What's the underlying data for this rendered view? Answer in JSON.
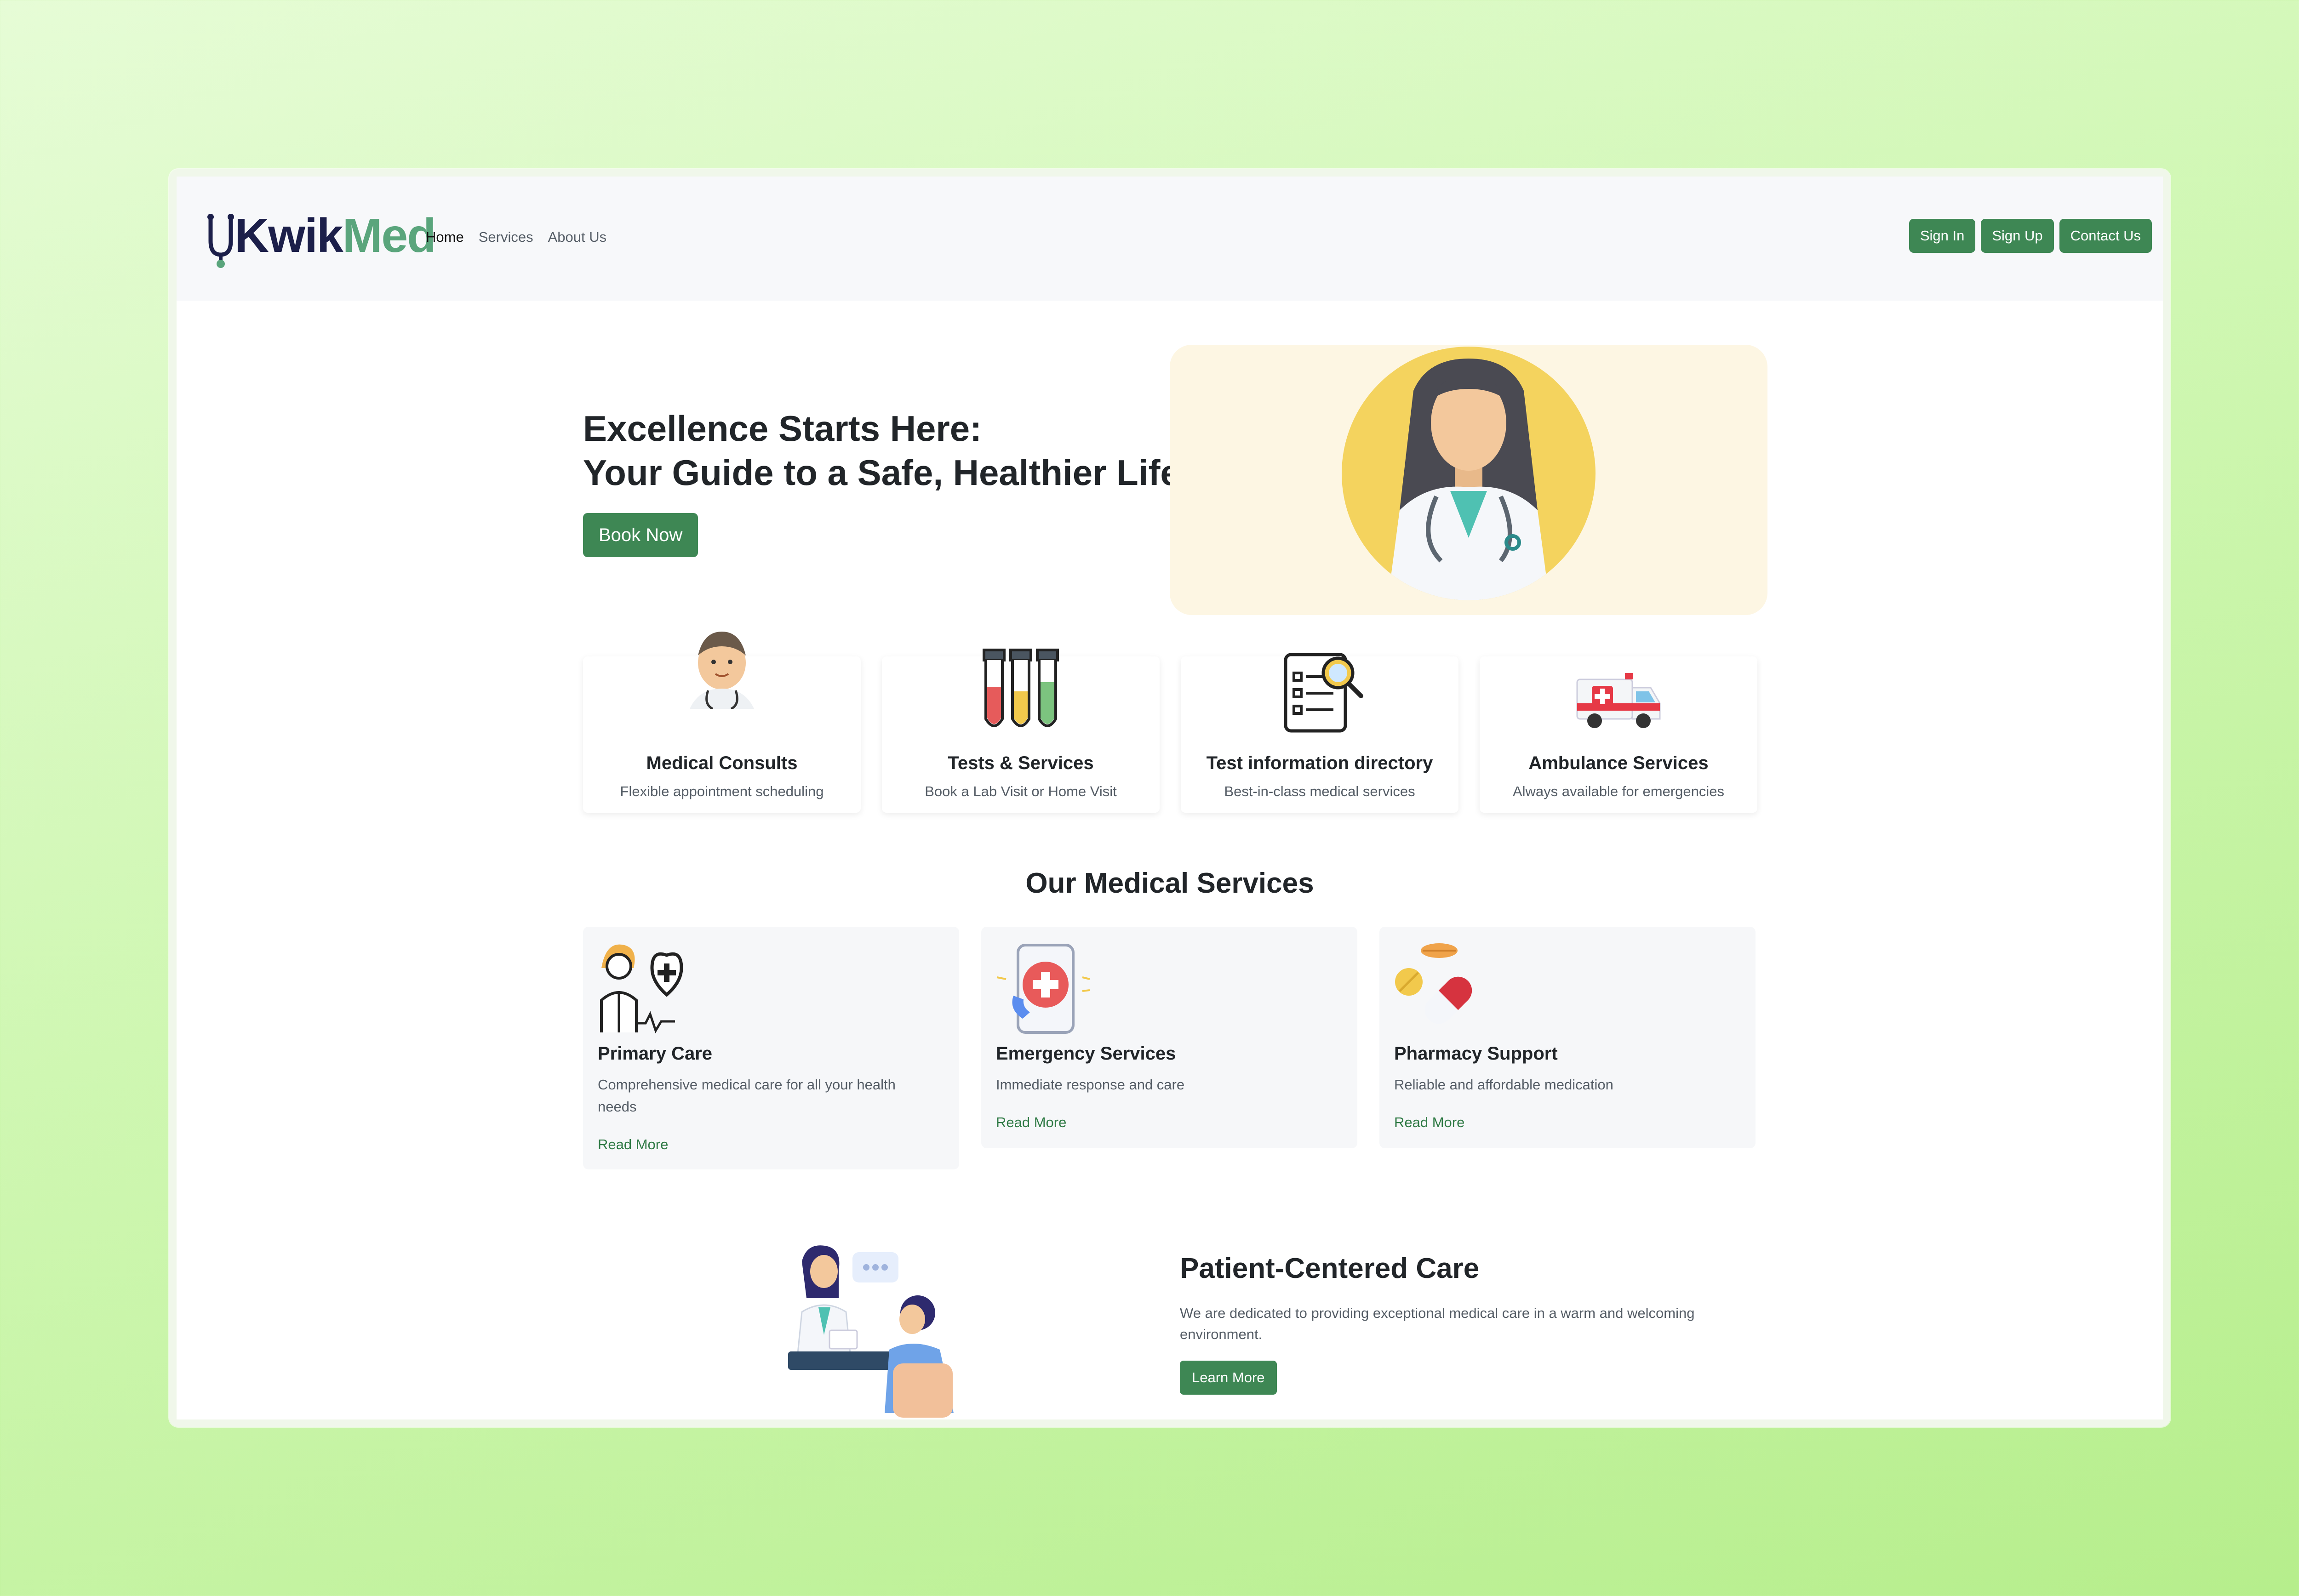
{
  "brand": {
    "name_part1": "Kwik",
    "name_part2": "Med"
  },
  "nav": {
    "links": [
      "Home",
      "Services",
      "About Us"
    ],
    "active": "Home",
    "buttons": [
      "Sign In",
      "Sign Up",
      "Contact Us"
    ]
  },
  "hero": {
    "title_line1": "Excellence Starts Here:",
    "title_line2": "Your Guide to a Safe, Healthier Life",
    "cta": "Book Now",
    "image_icon": "female-doctor-illustration"
  },
  "features": [
    {
      "title": "Medical Consults",
      "subtitle": "Flexible appointment scheduling",
      "icon": "doctor-icon"
    },
    {
      "title": "Tests & Services",
      "subtitle": "Book a Lab Visit or Home Visit",
      "icon": "test-tubes-icon"
    },
    {
      "title": "Test information directory",
      "subtitle": "Best-in-class medical services",
      "icon": "clipboard-search-icon"
    },
    {
      "title": "Ambulance Services",
      "subtitle": "Always available for emergencies",
      "icon": "ambulance-icon"
    }
  ],
  "services_section": {
    "title": "Our Medical Services",
    "cards": [
      {
        "title": "Primary Care",
        "description": "Comprehensive medical care for all your health needs",
        "link": "Read More",
        "icon": "doctor-heart-icon"
      },
      {
        "title": "Emergency Services",
        "description": "Immediate response and care",
        "link": "Read More",
        "icon": "phone-medical-icon"
      },
      {
        "title": "Pharmacy Support",
        "description": "Reliable and affordable medication",
        "link": "Read More",
        "icon": "pills-icon"
      }
    ]
  },
  "patient_care": {
    "title": "Patient-Centered Care",
    "description": "We are dedicated to providing exceptional medical care in a warm and welcoming environment.",
    "cta": "Learn More",
    "image_icon": "doctor-patient-consultation-illustration"
  },
  "colors": {
    "primary_green": "#3e8754",
    "brand_navy": "#1c1f4a",
    "brand_green": "#5aa57c",
    "hero_bg": "#fdf6e3"
  }
}
